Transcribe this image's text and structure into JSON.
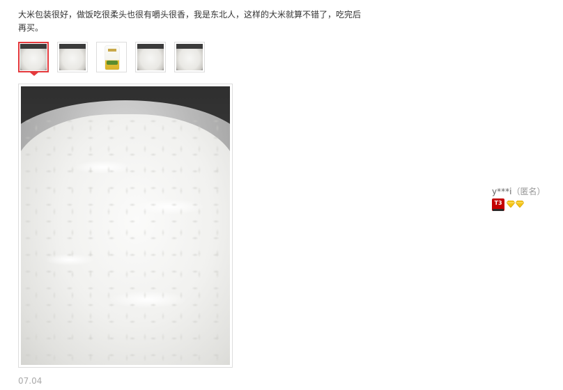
{
  "review": {
    "text": "大米包装很好，做饭吃很柔头也很有嚼头很香，我是东北人，这样的大米就算不错了，吃完后再买。",
    "date": "07.04"
  },
  "thumbnails": [
    {
      "kind": "rice-photo",
      "selected": true
    },
    {
      "kind": "rice-photo",
      "selected": false
    },
    {
      "kind": "rice-bag",
      "selected": false
    },
    {
      "kind": "rice-photo",
      "selected": false
    },
    {
      "kind": "rice-photo",
      "selected": false
    }
  ],
  "main_image": {
    "kind": "cooked-rice-photo"
  },
  "reviewer": {
    "name": "y***i",
    "anonymous_tag": "（匿名）",
    "level_badge": "T3",
    "diamond_count": 2,
    "badge_color": "#c40000",
    "diamond_color": "#f5c518"
  },
  "colors": {
    "accent": "#e4393c",
    "text": "#333333",
    "muted": "#999999"
  }
}
